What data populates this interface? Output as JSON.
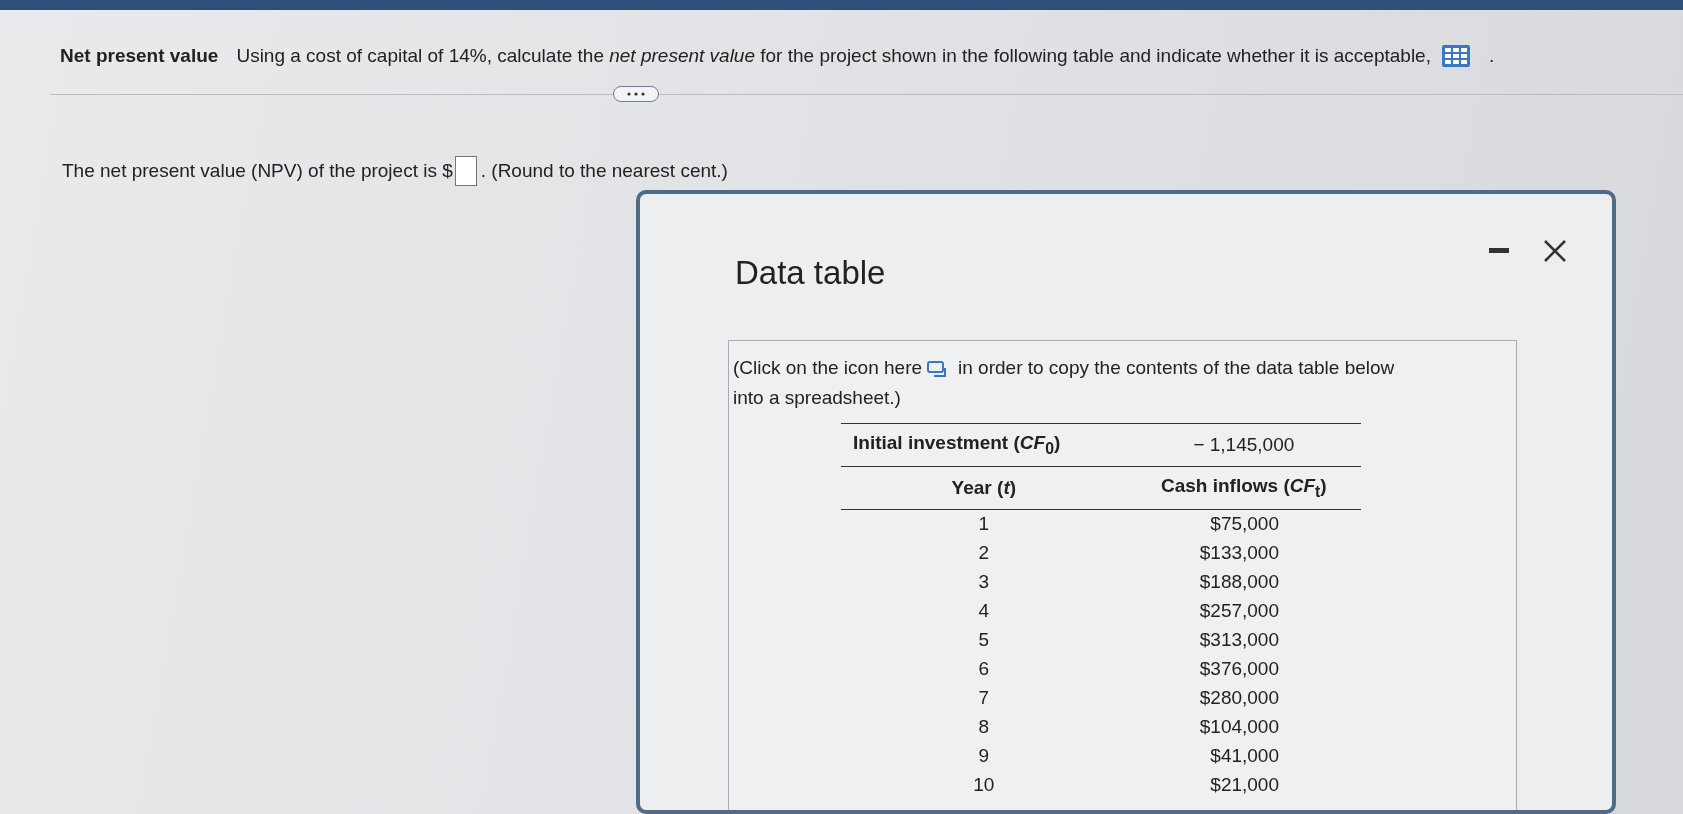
{
  "question": {
    "label": "Net present value",
    "text": "Using a cost of capital of 14%, calculate the *net present value* for the project shown in the following table and indicate whether it is acceptable,",
    "end": "."
  },
  "answer": {
    "prefix": "The net present value (NPV) of the project is $",
    "suffix": ". (Round to the nearest cent.)"
  },
  "dialog": {
    "title": "Data table",
    "instructions_before": "(Click on the icon here",
    "instructions_after": "in order to copy the contents of the data table below",
    "instructions_end": "into a spreadsheet.)",
    "table": {
      "initial": {
        "label": "Initial investment (*CF*$_{0}$)",
        "value": "− 1,145,000"
      },
      "columns": [
        "Year (*t*)",
        "Cash inflows (*CF*$_{t}$)"
      ],
      "rows": [
        {
          "year": "1",
          "cash": "$75,000"
        },
        {
          "year": "2",
          "cash": "$133,000"
        },
        {
          "year": "3",
          "cash": "$188,000"
        },
        {
          "year": "4",
          "cash": "$257,000"
        },
        {
          "year": "5",
          "cash": "$313,000"
        },
        {
          "year": "6",
          "cash": "$376,000"
        },
        {
          "year": "7",
          "cash": "$280,000"
        },
        {
          "year": "8",
          "cash": "$104,000"
        },
        {
          "year": "9",
          "cash": "$41,000"
        },
        {
          "year": "10",
          "cash": "$21,000"
        }
      ]
    }
  }
}
